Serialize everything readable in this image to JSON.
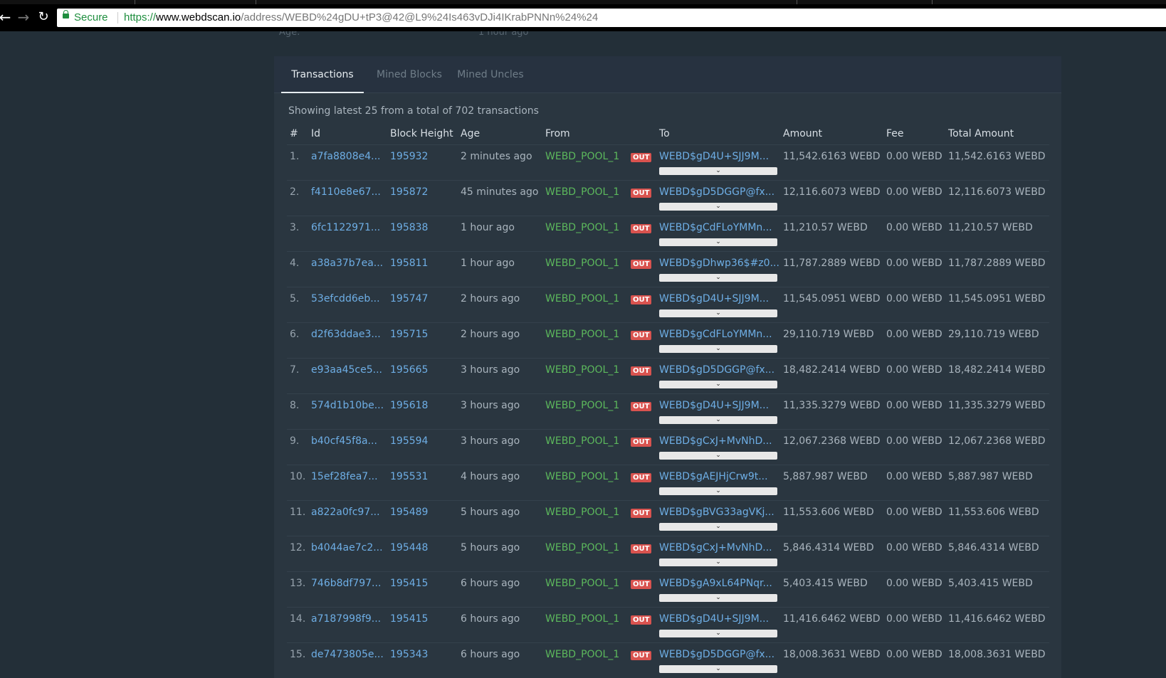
{
  "browser": {
    "secure_label": "Secure",
    "url_scheme": "https://",
    "url_host": "www.webdscan.io",
    "url_path": "/address/WEBD%24gDU+tP3@42@L9%24Is463vDJi4IKrabPNNn%24%24"
  },
  "page": {
    "faded_label": "Age:",
    "faded_value": "1 hour ago"
  },
  "tabs": [
    "Transactions",
    "Mined Blocks",
    "Mined Uncles"
  ],
  "summary": "Showing latest 25 from a total of 702 transactions",
  "columns": [
    "#",
    "Id",
    "Block Height",
    "Age",
    "From",
    "",
    "To",
    "Amount",
    "Fee",
    "Total Amount"
  ],
  "direction_label": "OUT",
  "expand_glyph": "⌄",
  "rows": [
    {
      "n": "1.",
      "id": "a7fa8808e4...",
      "block": "195932",
      "age": "2 minutes ago",
      "from": "WEBD_POOL_1",
      "to": "WEBD$gD4U+SJJ9M...",
      "amount": "11,542.6163 WEBD",
      "fee": "0.00 WEBD",
      "total": "11,542.6163 WEBD"
    },
    {
      "n": "2.",
      "id": "f4110e8e67...",
      "block": "195872",
      "age": "45 minutes ago",
      "from": "WEBD_POOL_1",
      "to": "WEBD$gD5DGGP@fx...",
      "amount": "12,116.6073 WEBD",
      "fee": "0.00 WEBD",
      "total": "12,116.6073 WEBD"
    },
    {
      "n": "3.",
      "id": "6fc1122971...",
      "block": "195838",
      "age": "1 hour ago",
      "from": "WEBD_POOL_1",
      "to": "WEBD$gCdFLoYMMn...",
      "amount": "11,210.57 WEBD",
      "fee": "0.00 WEBD",
      "total": "11,210.57 WEBD"
    },
    {
      "n": "4.",
      "id": "a38a37b7ea...",
      "block": "195811",
      "age": "1 hour ago",
      "from": "WEBD_POOL_1",
      "to": "WEBD$gDhwp36$#z0...",
      "amount": "11,787.2889 WEBD",
      "fee": "0.00 WEBD",
      "total": "11,787.2889 WEBD"
    },
    {
      "n": "5.",
      "id": "53efcdd6eb...",
      "block": "195747",
      "age": "2 hours ago",
      "from": "WEBD_POOL_1",
      "to": "WEBD$gD4U+SJJ9M...",
      "amount": "11,545.0951 WEBD",
      "fee": "0.00 WEBD",
      "total": "11,545.0951 WEBD"
    },
    {
      "n": "6.",
      "id": "d2f63ddae3...",
      "block": "195715",
      "age": "2 hours ago",
      "from": "WEBD_POOL_1",
      "to": "WEBD$gCdFLoYMMn...",
      "amount": "29,110.719 WEBD",
      "fee": "0.00 WEBD",
      "total": "29,110.719 WEBD"
    },
    {
      "n": "7.",
      "id": "e93aa45ce5...",
      "block": "195665",
      "age": "3 hours ago",
      "from": "WEBD_POOL_1",
      "to": "WEBD$gD5DGGP@fx...",
      "amount": "18,482.2414 WEBD",
      "fee": "0.00 WEBD",
      "total": "18,482.2414 WEBD"
    },
    {
      "n": "8.",
      "id": "574d1b10be...",
      "block": "195618",
      "age": "3 hours ago",
      "from": "WEBD_POOL_1",
      "to": "WEBD$gD4U+SJJ9M...",
      "amount": "11,335.3279 WEBD",
      "fee": "0.00 WEBD",
      "total": "11,335.3279 WEBD"
    },
    {
      "n": "9.",
      "id": "b40cf45f8a...",
      "block": "195594",
      "age": "3 hours ago",
      "from": "WEBD_POOL_1",
      "to": "WEBD$gCxJ+MvNhD...",
      "amount": "12,067.2368 WEBD",
      "fee": "0.00 WEBD",
      "total": "12,067.2368 WEBD"
    },
    {
      "n": "10.",
      "id": "15ef28fea7...",
      "block": "195531",
      "age": "4 hours ago",
      "from": "WEBD_POOL_1",
      "to": "WEBD$gAEJHjCrw9t...",
      "amount": "5,887.987 WEBD",
      "fee": "0.00 WEBD",
      "total": "5,887.987 WEBD"
    },
    {
      "n": "11.",
      "id": "a822a0fc97...",
      "block": "195489",
      "age": "5 hours ago",
      "from": "WEBD_POOL_1",
      "to": "WEBD$gBVG33agVKj...",
      "amount": "11,553.606 WEBD",
      "fee": "0.00 WEBD",
      "total": "11,553.606 WEBD"
    },
    {
      "n": "12.",
      "id": "b4044ae7c2...",
      "block": "195448",
      "age": "5 hours ago",
      "from": "WEBD_POOL_1",
      "to": "WEBD$gCxJ+MvNhD...",
      "amount": "5,846.4314 WEBD",
      "fee": "0.00 WEBD",
      "total": "5,846.4314 WEBD"
    },
    {
      "n": "13.",
      "id": "746b8df797...",
      "block": "195415",
      "age": "6 hours ago",
      "from": "WEBD_POOL_1",
      "to": "WEBD$gA9xL64PNqr...",
      "amount": "5,403.415 WEBD",
      "fee": "0.00 WEBD",
      "total": "5,403.415 WEBD"
    },
    {
      "n": "14.",
      "id": "a7187998f9...",
      "block": "195415",
      "age": "6 hours ago",
      "from": "WEBD_POOL_1",
      "to": "WEBD$gD4U+SJJ9M...",
      "amount": "11,416.6462 WEBD",
      "fee": "0.00 WEBD",
      "total": "11,416.6462 WEBD"
    },
    {
      "n": "15.",
      "id": "de7473805e...",
      "block": "195343",
      "age": "6 hours ago",
      "from": "WEBD_POOL_1",
      "to": "WEBD$gD5DGGP@fx...",
      "amount": "18,008.3631 WEBD",
      "fee": "0.00 WEBD",
      "total": "18,008.3631 WEBD"
    }
  ],
  "colors": {
    "background": "#232f38",
    "link": "#6eaee5",
    "pool": "#5cb85c",
    "out_badge": "#d9534f"
  }
}
